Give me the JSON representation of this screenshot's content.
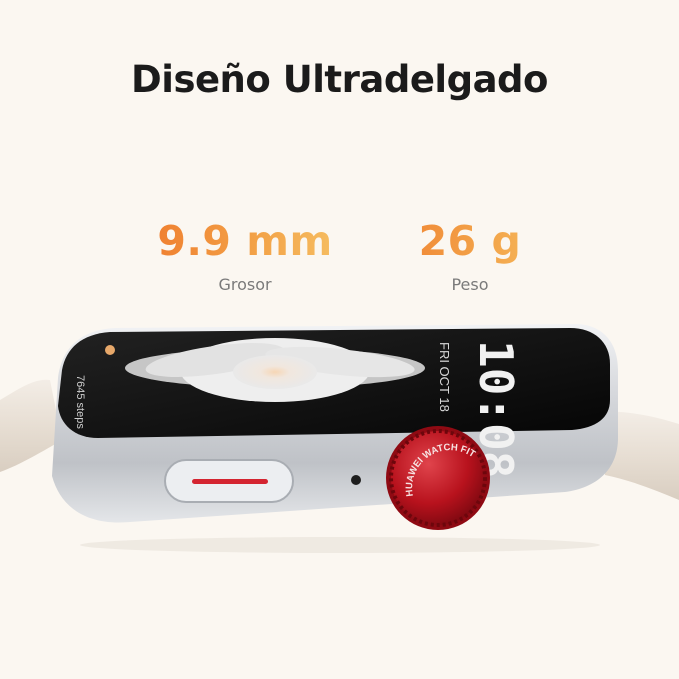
{
  "headline": "Diseño Ultradelgado",
  "specs": [
    {
      "value": "9.9 mm",
      "label": "Grosor"
    },
    {
      "value": "26 g",
      "label": "Peso"
    }
  ],
  "watch_screen": {
    "time": "10:08",
    "date": "FRI OCT 18",
    "steps": "7645 steps"
  },
  "crown_text": "HUAWEI WATCH FIT",
  "colors": {
    "accent_orange": "#ef7d2e",
    "accent_yellow": "#f6c064",
    "crown_red": "#b8121d",
    "button_line": "#d42430"
  }
}
